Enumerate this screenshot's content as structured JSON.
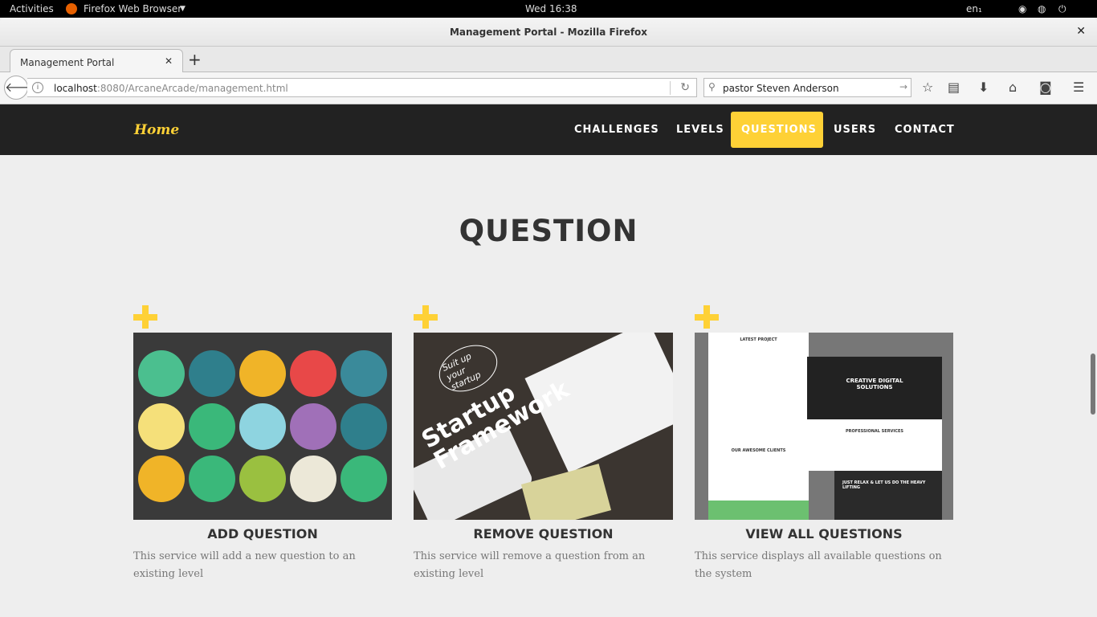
{
  "system": {
    "activities": "Activities",
    "app": "Firefox Web Browser",
    "clock": "Wed 16:38",
    "lang": "en₁"
  },
  "window": {
    "title": "Management Portal - Mozilla Firefox"
  },
  "tab": {
    "label": "Management Portal"
  },
  "url": {
    "host": "localhost",
    "path": ":8080/ArcaneArcade/management.html"
  },
  "search": {
    "value": "pastor Steven Anderson"
  },
  "site": {
    "brand": "Home",
    "menu": [
      "CHALLENGES",
      "LEVELS",
      "QUESTIONS",
      "USERS",
      "CONTACT"
    ],
    "active": "QUESTIONS"
  },
  "page": {
    "title": "QUESTION"
  },
  "cards": [
    {
      "title": "ADD QUESTION",
      "desc": "This service will add a new question to an existing level"
    },
    {
      "title": "REMOVE QUESTION",
      "desc": "This service will remove a question from an existing level",
      "img_text": [
        "Suit up your startup",
        "Startup Framework"
      ]
    },
    {
      "title": "VIEW ALL QUESTIONS",
      "desc": "This service displays all available questions on the system",
      "img_text": [
        "LATEST PROJECT",
        "CREATIVE DIGITAL SOLUTIONS",
        "PROFESSIONAL SERVICES",
        "OUR AWESOME CLIENTS",
        "JUST RELAX & LET US DO THE HEAVY LIFTING"
      ]
    }
  ],
  "colors": {
    "accent": "#fed136",
    "nav": "#222222"
  }
}
